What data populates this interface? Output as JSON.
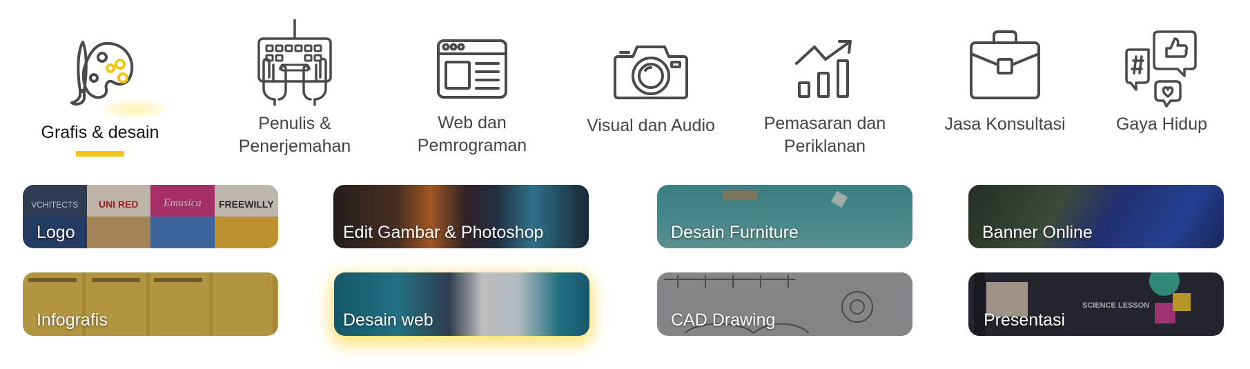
{
  "categories": [
    {
      "label": "Grafis & desain",
      "icon": "palette-brush-icon",
      "active": true
    },
    {
      "label": "Penulis & Penerjemahan",
      "icon": "keyboard-hands-icon"
    },
    {
      "label": "Web dan Pemrograman",
      "icon": "browser-window-icon"
    },
    {
      "label": "Visual dan Audio",
      "icon": "camera-icon"
    },
    {
      "label": "Pemasaran dan Periklanan",
      "icon": "growth-chart-icon"
    },
    {
      "label": "Jasa Konsultasi",
      "icon": "briefcase-icon"
    },
    {
      "label": "Gaya Hidup",
      "icon": "social-bubbles-icon"
    }
  ],
  "subcategories": [
    {
      "label": "Logo"
    },
    {
      "label": "Edit Gambar & Photoshop"
    },
    {
      "label": "Desain Furniture"
    },
    {
      "label": "Banner Online"
    },
    {
      "label": "Infografis"
    },
    {
      "label": "Desain web",
      "highlighted": true
    },
    {
      "label": "CAD Drawing"
    },
    {
      "label": "Presentasi"
    }
  ],
  "logo_tile_texts": {
    "a": "VCHITECTS",
    "b": "UNI RED",
    "c": "Emusica",
    "d": "FREEWILLY"
  },
  "presentation_tile_text": "SCIENCE LESSON",
  "colors": {
    "accent": "#f2c514",
    "text": "#444444",
    "icon_stroke": "#4a4a4a"
  }
}
